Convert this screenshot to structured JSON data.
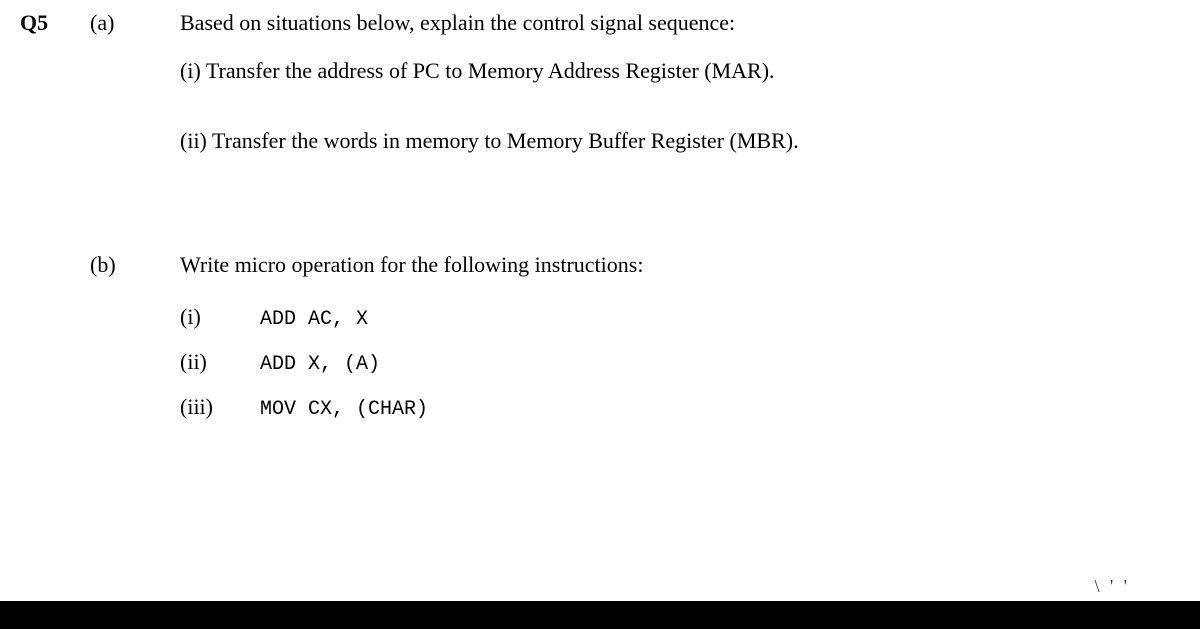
{
  "question": {
    "number": "Q5",
    "parts": {
      "a": {
        "label": "(a)",
        "prompt": "Based on situations below, explain the control signal sequence:",
        "items": [
          {
            "marker": "(i)",
            "text": "Transfer the address of PC to Memory Address Register (MAR)."
          },
          {
            "marker": "(ii)",
            "text": "Transfer the words in memory to Memory Buffer Register (MBR)."
          }
        ]
      },
      "b": {
        "label": "(b)",
        "prompt": "Write micro operation for the following instructions:",
        "items": [
          {
            "marker": "(i)",
            "code": "ADD AC, X"
          },
          {
            "marker": "(ii)",
            "code": "ADD X, (A)"
          },
          {
            "marker": "(iii)",
            "code": "MOV CX, (CHAR)"
          }
        ]
      }
    }
  },
  "scribble": "\\ ' '"
}
